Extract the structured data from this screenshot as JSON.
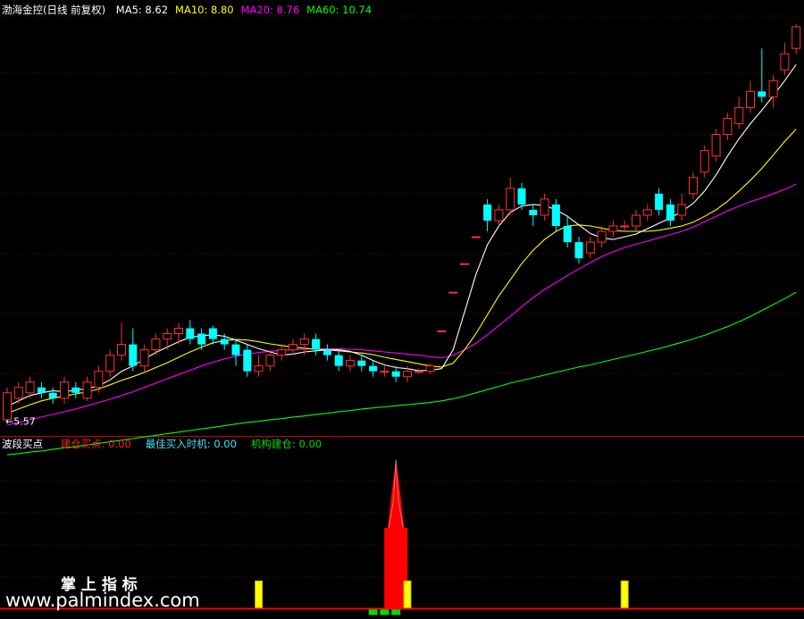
{
  "price_panel": {
    "title": "渤海金控(日线 前复权)",
    "ma_labels": [
      {
        "label": "MA5: 8.62",
        "color": "#ffffff"
      },
      {
        "label": "MA10: 8.80",
        "color": "#ffff00"
      },
      {
        "label": "MA20: 8.76",
        "color": "#ff00ff"
      },
      {
        "label": "MA60: 10.74",
        "color": "#00ff00"
      }
    ],
    "low_marker": "5.57"
  },
  "indicator_panel": {
    "title": "波段买点",
    "labels": [
      {
        "label": "建仓买点: 0.00",
        "color": "#ff2020"
      },
      {
        "label": "最佳买入时机: 0.00",
        "color": "#40e0ff"
      },
      {
        "label": "机构建仓: 0.00",
        "color": "#00dd00"
      }
    ]
  },
  "watermark": {
    "line1": "掌 上 指 标",
    "line2": "www.palmindex.com"
  },
  "colors": {
    "up": "#ff3030",
    "down": "#00ffff",
    "ma5": "#ffffff",
    "ma10": "#ffff00",
    "ma20": "#ff00ff",
    "ma60": "#00ff00",
    "grid": "#7a0000",
    "axis": "#cc0000"
  },
  "chart_data": [
    {
      "type": "candlestick",
      "ylim": [
        5.3,
        13.1
      ],
      "candles": [
        {
          "o": 5.6,
          "c": 6.1,
          "h": 6.2,
          "l": 5.57
        },
        {
          "o": 6.0,
          "c": 6.2,
          "h": 6.3,
          "l": 5.9
        },
        {
          "o": 6.1,
          "c": 6.3,
          "h": 6.4,
          "l": 6.0
        },
        {
          "o": 6.2,
          "c": 6.1,
          "h": 6.3,
          "l": 6.0
        },
        {
          "o": 6.1,
          "c": 6.0,
          "h": 6.2,
          "l": 5.9
        },
        {
          "o": 6.0,
          "c": 6.3,
          "h": 6.4,
          "l": 5.9
        },
        {
          "o": 6.2,
          "c": 6.1,
          "h": 6.3,
          "l": 6.0
        },
        {
          "o": 6.0,
          "c": 6.3,
          "h": 6.4,
          "l": 5.95
        },
        {
          "o": 6.2,
          "c": 6.5,
          "h": 6.6,
          "l": 6.1
        },
        {
          "o": 6.5,
          "c": 6.8,
          "h": 6.9,
          "l": 6.4
        },
        {
          "o": 6.8,
          "c": 7.0,
          "h": 7.4,
          "l": 6.7
        },
        {
          "o": 7.0,
          "c": 6.6,
          "h": 7.3,
          "l": 6.5
        },
        {
          "o": 6.6,
          "c": 6.9,
          "h": 7.0,
          "l": 6.5
        },
        {
          "o": 6.9,
          "c": 7.1,
          "h": 7.2,
          "l": 6.8
        },
        {
          "o": 7.1,
          "c": 7.2,
          "h": 7.3,
          "l": 6.9
        },
        {
          "o": 7.2,
          "c": 7.3,
          "h": 7.4,
          "l": 7.0
        },
        {
          "o": 7.3,
          "c": 7.1,
          "h": 7.45,
          "l": 7.0
        },
        {
          "o": 7.2,
          "c": 7.0,
          "h": 7.3,
          "l": 6.9
        },
        {
          "o": 7.3,
          "c": 7.1,
          "h": 7.35,
          "l": 7.0
        },
        {
          "o": 7.1,
          "c": 7.0,
          "h": 7.2,
          "l": 6.9
        },
        {
          "o": 7.0,
          "c": 6.8,
          "h": 7.1,
          "l": 6.6
        },
        {
          "o": 6.9,
          "c": 6.5,
          "h": 7.0,
          "l": 6.4
        },
        {
          "o": 6.5,
          "c": 6.6,
          "h": 6.8,
          "l": 6.4
        },
        {
          "o": 6.6,
          "c": 6.8,
          "h": 6.9,
          "l": 6.5
        },
        {
          "o": 6.8,
          "c": 6.9,
          "h": 7.0,
          "l": 6.7
        },
        {
          "o": 6.9,
          "c": 7.0,
          "h": 7.1,
          "l": 6.8
        },
        {
          "o": 7.0,
          "c": 7.1,
          "h": 7.2,
          "l": 6.8
        },
        {
          "o": 7.1,
          "c": 6.9,
          "h": 7.2,
          "l": 6.8
        },
        {
          "o": 6.9,
          "c": 6.8,
          "h": 7.0,
          "l": 6.7
        },
        {
          "o": 6.8,
          "c": 6.6,
          "h": 6.9,
          "l": 6.5
        },
        {
          "o": 6.6,
          "c": 6.7,
          "h": 6.8,
          "l": 6.5
        },
        {
          "o": 6.7,
          "c": 6.6,
          "h": 6.8,
          "l": 6.5
        },
        {
          "o": 6.6,
          "c": 6.5,
          "h": 6.7,
          "l": 6.4
        },
        {
          "o": 6.5,
          "c": 6.5,
          "h": 6.6,
          "l": 6.4
        },
        {
          "o": 6.5,
          "c": 6.4,
          "h": 6.6,
          "l": 6.3
        },
        {
          "o": 6.4,
          "c": 6.5,
          "h": 6.6,
          "l": 6.3
        },
        {
          "o": 6.5,
          "c": 6.5,
          "h": 6.55,
          "l": 6.45
        },
        {
          "o": 6.5,
          "c": 6.6,
          "h": 6.65,
          "l": 6.45
        },
        {
          "o": 7.25,
          "c": 7.25,
          "h": 7.25,
          "l": 7.25
        },
        {
          "o": 7.97,
          "c": 7.97,
          "h": 7.97,
          "l": 7.97
        },
        {
          "o": 8.5,
          "c": 8.5,
          "h": 8.5,
          "l": 8.5
        },
        {
          "o": 9.0,
          "c": 9.0,
          "h": 9.0,
          "l": 9.0
        },
        {
          "o": 9.6,
          "c": 9.3,
          "h": 9.7,
          "l": 9.1
        },
        {
          "o": 9.3,
          "c": 9.5,
          "h": 9.6,
          "l": 9.2
        },
        {
          "o": 9.5,
          "c": 9.9,
          "h": 10.1,
          "l": 9.4
        },
        {
          "o": 9.9,
          "c": 9.6,
          "h": 10.0,
          "l": 9.5
        },
        {
          "o": 9.5,
          "c": 9.4,
          "h": 9.6,
          "l": 9.2
        },
        {
          "o": 9.4,
          "c": 9.7,
          "h": 9.8,
          "l": 9.3
        },
        {
          "o": 9.6,
          "c": 9.2,
          "h": 9.7,
          "l": 9.1
        },
        {
          "o": 9.2,
          "c": 8.9,
          "h": 9.4,
          "l": 8.8
        },
        {
          "o": 8.9,
          "c": 8.6,
          "h": 9.0,
          "l": 8.5
        },
        {
          "o": 8.7,
          "c": 8.9,
          "h": 9.0,
          "l": 8.6
        },
        {
          "o": 8.9,
          "c": 9.1,
          "h": 9.2,
          "l": 8.8
        },
        {
          "o": 9.1,
          "c": 9.2,
          "h": 9.3,
          "l": 9.0
        },
        {
          "o": 9.2,
          "c": 9.2,
          "h": 9.3,
          "l": 9.1
        },
        {
          "o": 9.2,
          "c": 9.4,
          "h": 9.5,
          "l": 9.1
        },
        {
          "o": 9.4,
          "c": 9.5,
          "h": 9.6,
          "l": 9.3
        },
        {
          "o": 9.8,
          "c": 9.5,
          "h": 9.9,
          "l": 9.4
        },
        {
          "o": 9.6,
          "c": 9.3,
          "h": 9.7,
          "l": 9.2
        },
        {
          "o": 9.4,
          "c": 9.6,
          "h": 9.8,
          "l": 9.3
        },
        {
          "o": 9.8,
          "c": 10.1,
          "h": 10.2,
          "l": 9.7
        },
        {
          "o": 10.2,
          "c": 10.6,
          "h": 10.7,
          "l": 10.1
        },
        {
          "o": 10.5,
          "c": 10.9,
          "h": 11.0,
          "l": 10.4
        },
        {
          "o": 10.9,
          "c": 11.2,
          "h": 11.3,
          "l": 10.8
        },
        {
          "o": 11.1,
          "c": 11.4,
          "h": 11.6,
          "l": 11.0
        },
        {
          "o": 11.4,
          "c": 11.7,
          "h": 11.9,
          "l": 11.3
        },
        {
          "o": 11.7,
          "c": 11.6,
          "h": 12.5,
          "l": 11.5
        },
        {
          "o": 11.6,
          "c": 11.9,
          "h": 12.0,
          "l": 11.4
        },
        {
          "o": 12.1,
          "c": 12.4,
          "h": 12.6,
          "l": 12.0
        },
        {
          "o": 12.5,
          "c": 12.9,
          "h": 12.95,
          "l": 12.4
        }
      ],
      "ma5": [
        5.85,
        5.95,
        6.05,
        6.1,
        6.14,
        6.12,
        6.15,
        6.18,
        6.23,
        6.34,
        6.5,
        6.6,
        6.73,
        6.85,
        6.95,
        7.05,
        7.13,
        7.16,
        7.18,
        7.15,
        7.08,
        7.0,
        6.92,
        6.86,
        6.8,
        6.82,
        6.86,
        6.88,
        6.9,
        6.9,
        6.87,
        6.8,
        6.7,
        6.62,
        6.57,
        6.55,
        6.51,
        6.52,
        6.55,
        6.9,
        7.6,
        8.3,
        8.85,
        9.2,
        9.45,
        9.57,
        9.6,
        9.58,
        9.5,
        9.38,
        9.22,
        9.06,
        8.98,
        8.95,
        9.0,
        9.05,
        9.15,
        9.25,
        9.35,
        9.47,
        9.62,
        9.85,
        10.15,
        10.5,
        10.82,
        11.1,
        11.35,
        11.62,
        11.9,
        12.2
      ],
      "ma10": [
        5.72,
        5.8,
        5.88,
        5.95,
        6.0,
        6.04,
        6.08,
        6.12,
        6.17,
        6.25,
        6.33,
        6.4,
        6.48,
        6.57,
        6.66,
        6.76,
        6.86,
        6.95,
        7.03,
        7.07,
        7.09,
        7.08,
        7.05,
        7.01,
        6.98,
        6.95,
        6.93,
        6.91,
        6.9,
        6.88,
        6.86,
        6.84,
        6.81,
        6.76,
        6.72,
        6.68,
        6.64,
        6.6,
        6.58,
        6.65,
        6.9,
        7.2,
        7.55,
        7.9,
        8.2,
        8.5,
        8.75,
        8.95,
        9.1,
        9.2,
        9.22,
        9.2,
        9.16,
        9.12,
        9.1,
        9.1,
        9.1,
        9.12,
        9.16,
        9.2,
        9.27,
        9.38,
        9.5,
        9.66,
        9.85,
        10.05,
        10.27,
        10.52,
        10.77,
        11.0
      ],
      "ma20": [
        5.5,
        5.55,
        5.6,
        5.65,
        5.7,
        5.75,
        5.8,
        5.86,
        5.92,
        5.98,
        6.05,
        6.12,
        6.2,
        6.28,
        6.36,
        6.44,
        6.52,
        6.6,
        6.67,
        6.73,
        6.78,
        6.82,
        6.85,
        6.87,
        6.89,
        6.9,
        6.91,
        6.92,
        6.92,
        6.92,
        6.91,
        6.9,
        6.88,
        6.86,
        6.84,
        6.82,
        6.8,
        6.77,
        6.75,
        6.8,
        6.9,
        7.02,
        7.18,
        7.35,
        7.52,
        7.7,
        7.87,
        8.02,
        8.15,
        8.28,
        8.4,
        8.52,
        8.63,
        8.72,
        8.8,
        8.86,
        8.92,
        8.98,
        9.04,
        9.1,
        9.18,
        9.28,
        9.38,
        9.48,
        9.57,
        9.65,
        9.72,
        9.8,
        9.88,
        9.98
      ],
      "ma60": [
        4.95,
        4.97,
        5.0,
        5.02,
        5.05,
        5.08,
        5.1,
        5.13,
        5.16,
        5.19,
        5.22,
        5.25,
        5.28,
        5.31,
        5.34,
        5.37,
        5.4,
        5.43,
        5.46,
        5.49,
        5.52,
        5.55,
        5.57,
        5.6,
        5.62,
        5.65,
        5.67,
        5.7,
        5.72,
        5.75,
        5.77,
        5.8,
        5.82,
        5.84,
        5.86,
        5.88,
        5.9,
        5.92,
        5.95,
        5.99,
        6.04,
        6.1,
        6.16,
        6.22,
        6.28,
        6.33,
        6.38,
        6.43,
        6.48,
        6.53,
        6.58,
        6.62,
        6.67,
        6.72,
        6.77,
        6.82,
        6.87,
        6.92,
        6.98,
        7.04,
        7.1,
        7.17,
        7.25,
        7.33,
        7.42,
        7.52,
        7.63,
        7.74,
        7.85,
        7.97
      ]
    },
    {
      "type": "bar",
      "ylim": [
        0,
        100
      ],
      "jiancang": [
        0,
        0,
        0,
        0,
        0,
        0,
        0,
        0,
        0,
        0,
        0,
        0,
        0,
        0,
        0,
        0,
        0,
        0,
        0,
        0,
        0,
        0,
        0,
        0,
        0,
        0,
        0,
        0,
        0,
        0,
        0,
        0,
        0,
        0,
        0,
        0,
        0,
        0,
        0,
        0,
        0,
        0,
        0,
        0,
        0,
        0,
        0,
        0,
        0,
        0,
        0,
        0,
        0,
        0,
        0,
        0,
        0,
        0,
        0,
        0,
        0,
        0,
        0,
        0,
        0,
        0,
        0,
        0,
        0,
        0
      ],
      "spike": {
        "index": 34,
        "plateau": 53,
        "peak": 98
      },
      "best_time": [
        0,
        0,
        0,
        0,
        0,
        0,
        0,
        0,
        0,
        0,
        0,
        0,
        0,
        0,
        0,
        0,
        0,
        0,
        0,
        0,
        0,
        0,
        18,
        0,
        0,
        0,
        0,
        0,
        0,
        0,
        0,
        0,
        0,
        0,
        0,
        18,
        0,
        0,
        0,
        0,
        0,
        0,
        0,
        0,
        0,
        0,
        0,
        0,
        0,
        0,
        0,
        0,
        0,
        0,
        18,
        0,
        0,
        0,
        0,
        0,
        0,
        0,
        0,
        0,
        0,
        0,
        0,
        0,
        0,
        0
      ],
      "institution": [
        0,
        0,
        0,
        0,
        0,
        0,
        0,
        0,
        0,
        0,
        0,
        0,
        0,
        0,
        0,
        0,
        0,
        0,
        0,
        0,
        0,
        0,
        0,
        0,
        0,
        0,
        0,
        0,
        0,
        0,
        0,
        0,
        4,
        4,
        4,
        0,
        0,
        0,
        0,
        0,
        0,
        0,
        0,
        0,
        0,
        0,
        0,
        0,
        0,
        0,
        0,
        0,
        0,
        0,
        0,
        0,
        0,
        0,
        0,
        0,
        0,
        0,
        0,
        0,
        0,
        0,
        0,
        0,
        0,
        0
      ]
    }
  ]
}
